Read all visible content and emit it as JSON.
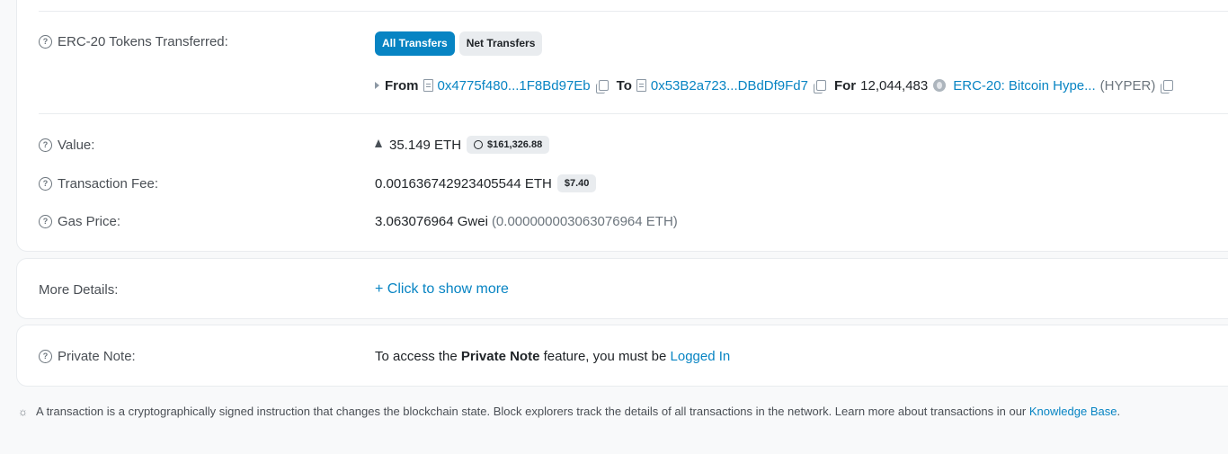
{
  "tokens_transferred": {
    "label": "ERC-20 Tokens Transferred:",
    "tabs": [
      "All Transfers",
      "Net Transfers"
    ],
    "transfer": {
      "from_label": "From",
      "from_address": "0x4775f480...1F8Bd97Eb",
      "to_label": "To",
      "to_address": "0x53B2a723...DBdDf9Fd7",
      "for_label": "For",
      "amount": "12,044,483",
      "token_name": "ERC-20: Bitcoin Hype...",
      "token_symbol": "(HYPER)"
    }
  },
  "value": {
    "label": "Value:",
    "amount": "35.149 ETH",
    "usd": "$161,326.88"
  },
  "transaction_fee": {
    "label": "Transaction Fee:",
    "amount": "0.001636742923405544 ETH",
    "usd": "$7.40"
  },
  "gas_price": {
    "label": "Gas Price:",
    "gwei": "3.063076964 Gwei",
    "eth": "(0.000000003063076964 ETH)"
  },
  "more_details": {
    "label": "More Details:",
    "link": "+ Click to show more"
  },
  "private_note": {
    "label": "Private Note:",
    "text_before": "To access the",
    "text_bold": "Private Note",
    "text_after": "feature, you must be",
    "link": "Logged In"
  },
  "footer": {
    "text": "A transaction is a cryptographically signed instruction that changes the blockchain state. Block explorers track the details of all transactions in the network. Learn more about transactions in our",
    "link": "Knowledge Base",
    "end": "."
  },
  "colors": {
    "accent": "#0784c3",
    "background": "#f8f9fa",
    "card": "#ffffff"
  }
}
